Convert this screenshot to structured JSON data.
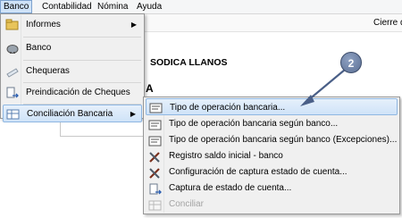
{
  "menubar": {
    "items": [
      "Banco",
      "Contabilidad",
      "Nómina",
      "Ayuda"
    ]
  },
  "toolbar": {
    "cierre": "Cierre d"
  },
  "background": {
    "company": "SODICA LLANOS",
    "section_letter": "A"
  },
  "banco_menu": {
    "items": [
      {
        "label": "Informes",
        "icon": "folder-icon",
        "submenu": true
      },
      {
        "label": "Banco",
        "icon": "piggy-bank-icon"
      },
      {
        "label": "Chequeras",
        "icon": "checkbook-icon"
      },
      {
        "label": "Preindicación de Cheques",
        "icon": "document-arrow-icon"
      },
      {
        "label": "Conciliación Bancaria",
        "icon": "table-grid-icon",
        "submenu": true
      }
    ]
  },
  "conciliacion_menu": {
    "items": [
      {
        "label": "Tipo de operación bancaria...",
        "icon": "list-form-icon"
      },
      {
        "label": "Tipo de operación bancaria según banco...",
        "icon": "list-form-icon"
      },
      {
        "label": "Tipo de operación bancaria según banco (Excepciones)...",
        "icon": "list-form-icon"
      },
      {
        "label": "Registro saldo inicial - banco",
        "icon": "tools-icon"
      },
      {
        "label": "Configuración de captura estado de cuenta...",
        "icon": "tools-icon"
      },
      {
        "label": "Captura de estado de cuenta...",
        "icon": "document-arrow-icon"
      },
      {
        "label": "Conciliar",
        "icon": "table-grid-icon",
        "disabled": true
      }
    ]
  },
  "annotation": {
    "step": "2"
  },
  "colors": {
    "highlight": "#cfe3f8",
    "menu_bg": "#f0f0f0",
    "badge": "#5b6f94"
  }
}
